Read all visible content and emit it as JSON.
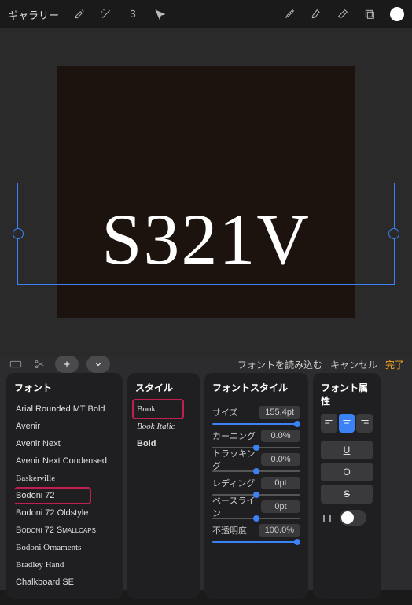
{
  "topbar": {
    "gallery_label": "ギャラリー"
  },
  "canvas": {
    "text_content": "S321V"
  },
  "panel": {
    "import_font_label": "フォントを読み込む",
    "cancel_label": "キャンセル",
    "done_label": "完了"
  },
  "fonts": {
    "header": "フォント",
    "items": [
      {
        "label": "Arial Rounded MT Bold",
        "family": "Arial Rounded MT Bold, Arial"
      },
      {
        "label": "Avenir",
        "family": "Avenir, sans-serif"
      },
      {
        "label": "Avenir Next",
        "family": "Avenir Next, sans-serif"
      },
      {
        "label": "Avenir Next Condensed",
        "family": "Avenir Next Condensed, sans-serif"
      },
      {
        "label": "Baskerville",
        "family": "Baskerville, serif"
      },
      {
        "label": "Bodoni 72",
        "family": "Bodoni 72, Didot, serif",
        "selected": true
      },
      {
        "label": "Bodoni 72 Oldstyle",
        "family": "Bodoni 72 Oldstyle, Didot, serif"
      },
      {
        "label": "Bodoni 72 Smallcaps",
        "family": "Bodoni 72 Smallcaps, Didot, serif",
        "variant": "small-caps"
      },
      {
        "label": "Bodoni Ornaments",
        "family": "Bodoni Ornaments, serif"
      },
      {
        "label": "Bradley Hand",
        "family": "Bradley Hand, cursive"
      },
      {
        "label": "Chalkboard SE",
        "family": "Chalkboard SE, sans-serif"
      }
    ]
  },
  "styles": {
    "header": "スタイル",
    "items": [
      {
        "label": "Book",
        "selected": true
      },
      {
        "label": "Book Italic",
        "italic": true
      },
      {
        "label": "Bold",
        "bold": true
      }
    ]
  },
  "font_style": {
    "header": "フォントスタイル",
    "rows": [
      {
        "label": "サイズ",
        "value": "155.4pt",
        "slider": "full"
      },
      {
        "label": "カーニング",
        "value": "0.0%",
        "slider": "mid"
      },
      {
        "label": "トラッキング",
        "value": "0.0%",
        "slider": "mid"
      },
      {
        "label": "レディング",
        "value": "0pt",
        "slider": "mid"
      },
      {
        "label": "ベースライン",
        "value": "0pt",
        "slider": "mid"
      },
      {
        "label": "不透明度",
        "value": "100.0%",
        "slider": "full"
      }
    ]
  },
  "attrs": {
    "header": "フォント属性",
    "underline": "U",
    "outline": "O",
    "strike": "S",
    "tt_label": "TT"
  }
}
